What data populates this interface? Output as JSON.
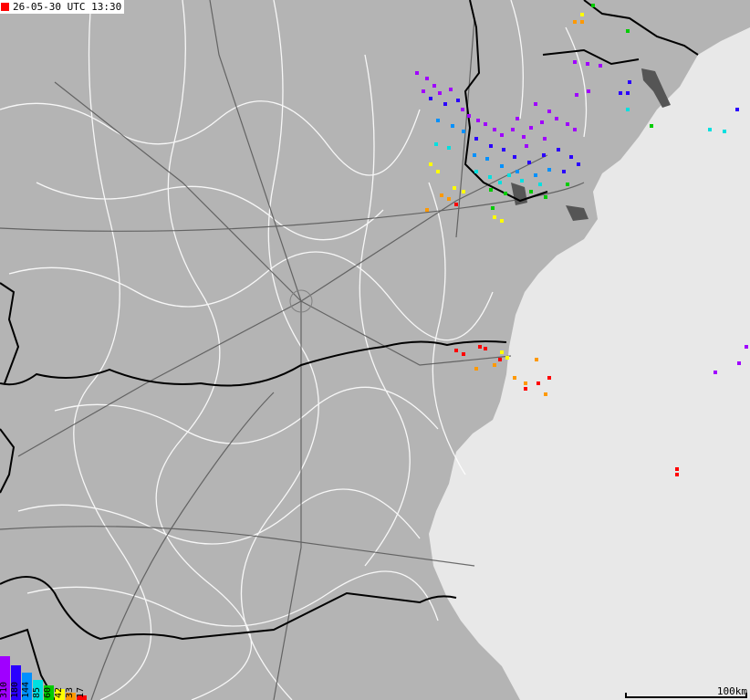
{
  "timestamp": "26-05-30 UTC 13:30",
  "scale_label": "100km",
  "legend": [
    {
      "label": "310",
      "color": "#a000ff"
    },
    {
      "label": "180",
      "color": "#2a00ff"
    },
    {
      "label": "144",
      "color": "#0090ff"
    },
    {
      "label": "85",
      "color": "#00e0e0"
    },
    {
      "label": "60",
      "color": "#00cc00"
    },
    {
      "label": "42",
      "color": "#ffff00"
    },
    {
      "label": "33",
      "color": "#ff9900"
    },
    {
      "label": "17",
      "color": "#ff0000"
    }
  ],
  "colors": {
    "land": "#b4b4b4",
    "sea": "#e8e8e8",
    "borders": "#000000",
    "regions": "#ffffff",
    "roads": "#555555"
  }
}
